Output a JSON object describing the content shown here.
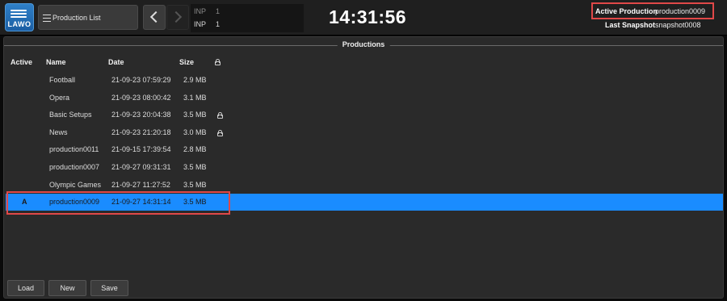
{
  "logo": {
    "text": "LAWO"
  },
  "header": {
    "menu_label": "Production List",
    "inputs": [
      {
        "label": "INP",
        "value": "1"
      },
      {
        "label": "INP",
        "value": "1"
      }
    ],
    "clock": "14:31:56",
    "active_production_label": "Active Production",
    "active_production_value": "production0009",
    "last_snapshot_label": "Last Snapshot",
    "last_snapshot_value": "snapshot0008"
  },
  "panel": {
    "title": "Productions",
    "columns": {
      "active": "Active",
      "name": "Name",
      "date": "Date",
      "size": "Size",
      "lock": "lock-icon"
    },
    "rows": [
      {
        "active": "",
        "name": "Football",
        "date": "21-09-23 07:59:29",
        "size": "2.9 MB",
        "locked": false,
        "selected": false
      },
      {
        "active": "",
        "name": "Opera",
        "date": "21-09-23 08:00:42",
        "size": "3.1 MB",
        "locked": false,
        "selected": false
      },
      {
        "active": "",
        "name": "Basic Setups",
        "date": "21-09-23 20:04:38",
        "size": "3.5 MB",
        "locked": true,
        "selected": false
      },
      {
        "active": "",
        "name": "News",
        "date": "21-09-23 21:20:18",
        "size": "3.0 MB",
        "locked": true,
        "selected": false
      },
      {
        "active": "",
        "name": "production0011",
        "date": "21-09-15 17:39:54",
        "size": "2.8 MB",
        "locked": false,
        "selected": false
      },
      {
        "active": "",
        "name": "production0007",
        "date": "21-09-27 09:31:31",
        "size": "3.5 MB",
        "locked": false,
        "selected": false
      },
      {
        "active": "",
        "name": "Olympic Games",
        "date": "21-09-27 11:27:52",
        "size": "3.5 MB",
        "locked": false,
        "selected": false
      },
      {
        "active": "A",
        "name": "production0009",
        "date": "21-09-27 14:31:14",
        "size": "3.5 MB",
        "locked": false,
        "selected": true
      }
    ]
  },
  "buttons": {
    "load": "Load",
    "new": "New",
    "save": "Save"
  },
  "colors": {
    "selection": "#1a8cff",
    "highlight_box": "#e04848",
    "active_marker": "#e03030"
  }
}
